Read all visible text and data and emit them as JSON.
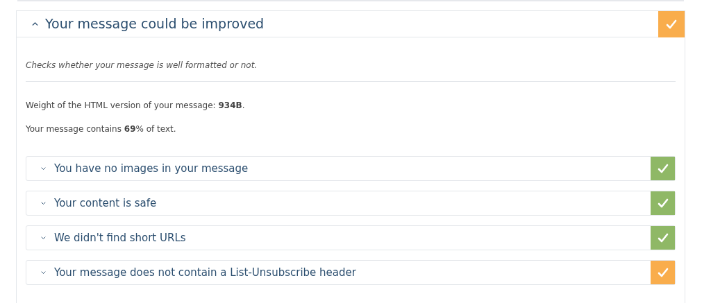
{
  "section": {
    "title": "Your message could be improved",
    "expanded": true,
    "color": "#f9ad4c",
    "description": "Checks whether your message is well formatted or not.",
    "facts": [
      "Weight of the HTML version of your message: **934B**.",
      "Your message contains **69**% of text."
    ],
    "checks": [
      {
        "title": "You have no images in your message",
        "expanded": false,
        "color": "#8fb866"
      },
      {
        "title": "Your content is safe",
        "expanded": false,
        "color": "#8fb866"
      },
      {
        "title": "We didn't find short URLs",
        "expanded": false,
        "color": "#8fb866"
      },
      {
        "title": "Your message does not contain a List-Unsubscribe header",
        "expanded": false,
        "color": "#f9ad4c"
      }
    ]
  }
}
